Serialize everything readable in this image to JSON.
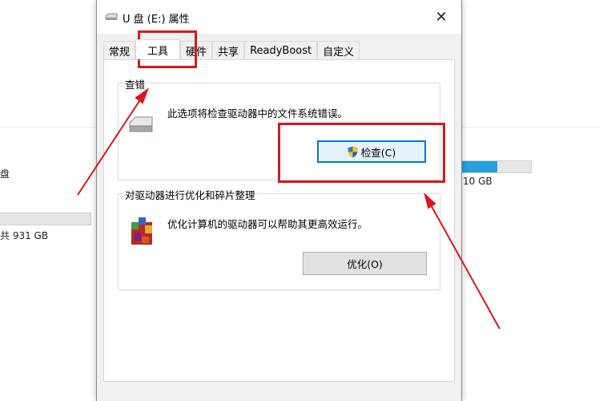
{
  "background": {
    "left_label": "盘",
    "left_size": "共 931 GB",
    "right_size": "10 GB"
  },
  "dialog": {
    "title": "U 盘 (E:) 属性",
    "close_glyph": "✕",
    "tabs": [
      "常规",
      "工具",
      "硬件",
      "共享",
      "ReadyBoost",
      "自定义"
    ],
    "active_tab": "工具",
    "error_check": {
      "legend": "查错",
      "description": "此选项将检查驱动器中的文件系统错误。",
      "button": "检查(C)"
    },
    "optimize": {
      "legend": "对驱动器进行优化和碎片整理",
      "description": "优化计算机的驱动器可以帮助其更高效运行。",
      "button": "优化(O)"
    }
  },
  "colors": {
    "annotation_red": "#d7191c",
    "focus_blue": "#0078d7",
    "progress_blue": "#26a0da"
  }
}
